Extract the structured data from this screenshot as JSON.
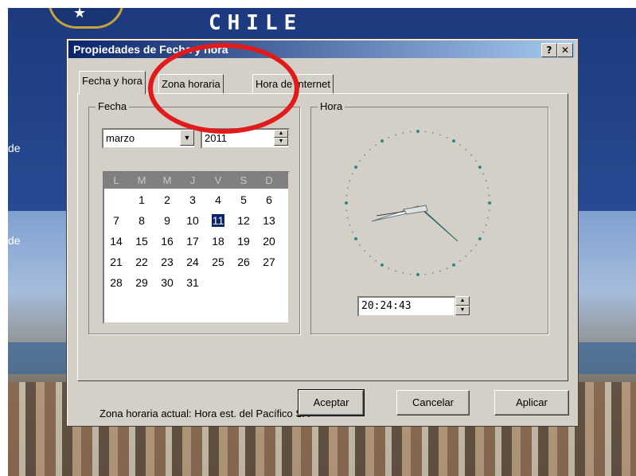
{
  "background": {
    "logo_text": "CHILE",
    "side_labels": [
      "de",
      "de"
    ]
  },
  "dialog": {
    "title": "Propiedades de Fecha y hora",
    "help_button": "?",
    "close_button": "✕",
    "tabs": [
      "Fecha y hora",
      "Zona horaria",
      "Hora de Internet"
    ],
    "active_tab": "Fecha y hora",
    "date_group": {
      "label": "Fecha",
      "month": "marzo",
      "year": "2011",
      "weekday_headers": [
        "L",
        "M",
        "M",
        "J",
        "V",
        "S",
        "D"
      ],
      "weeks": [
        [
          "",
          "1",
          "2",
          "3",
          "4",
          "5",
          "6"
        ],
        [
          "7",
          "8",
          "9",
          "10",
          "11",
          "12",
          "13"
        ],
        [
          "14",
          "15",
          "16",
          "17",
          "18",
          "19",
          "20"
        ],
        [
          "21",
          "22",
          "23",
          "24",
          "25",
          "26",
          "27"
        ],
        [
          "28",
          "29",
          "30",
          "31",
          "",
          "",
          ""
        ]
      ],
      "selected_day": "11"
    },
    "time_group": {
      "label": "Hora",
      "time": "20:24:43"
    },
    "timezone_text": "Zona horaria actual:  Hora est. del Pacífico SA",
    "buttons": {
      "ok": "Aceptar",
      "cancel": "Cancelar",
      "apply": "Aplicar"
    }
  },
  "annotation": {
    "color": "#e11b1b"
  },
  "colors": {
    "titlebar": "#0a246a",
    "face": "#d4d0c8",
    "selection": "#0a246a"
  }
}
